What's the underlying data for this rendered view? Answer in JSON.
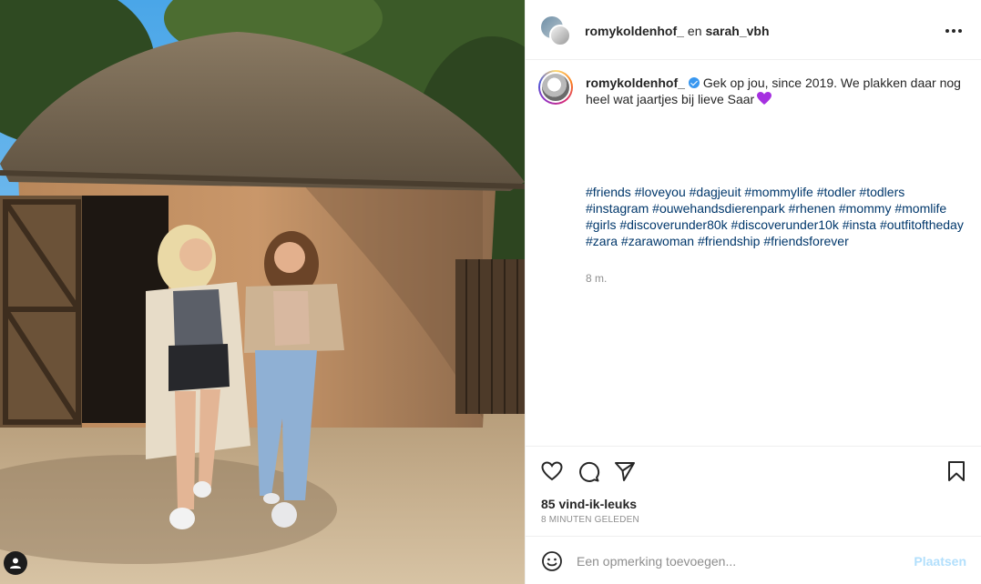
{
  "header": {
    "username_primary": "romykoldenhof_",
    "separator": "en",
    "username_secondary": "sarah_vbh",
    "more_icon": "more-horizontal-icon"
  },
  "caption": {
    "username": "romykoldenhof_",
    "text": "Gek op jou, since 2019. We plakken daar nog heel wat jaartjes bij lieve Saar",
    "emoji": "purple-heart-emoji",
    "hashtags": [
      "#friends",
      "#loveyou",
      "#dagjeuit",
      "#mommylife",
      "#todler",
      "#todlers",
      "#instagram",
      "#ouwehandsdierenpark",
      "#rhenen",
      "#mommy",
      "#momlife",
      "#girls",
      "#discoverunder80k",
      "#discoverunder10k",
      "#insta",
      "#outfitoftheday",
      "#zara",
      "#zarawoman",
      "#friendship",
      "#friendsforever"
    ],
    "time_short": "8 m."
  },
  "actions": {
    "like_icon": "heart-outline-icon",
    "comment_icon": "comment-bubble-icon",
    "share_icon": "paper-plane-icon",
    "save_icon": "bookmark-icon"
  },
  "stats": {
    "likes": "85 vind-ik-leuks",
    "time_full": "8 minuten geleden"
  },
  "comment_box": {
    "placeholder": "Een opmerking toevoegen...",
    "post_label": "Plaatsen"
  },
  "colors": {
    "link": "#00376b",
    "verified": "#3897f0",
    "post_disabled": "#b2dffc",
    "muted": "#8e8e8e"
  }
}
